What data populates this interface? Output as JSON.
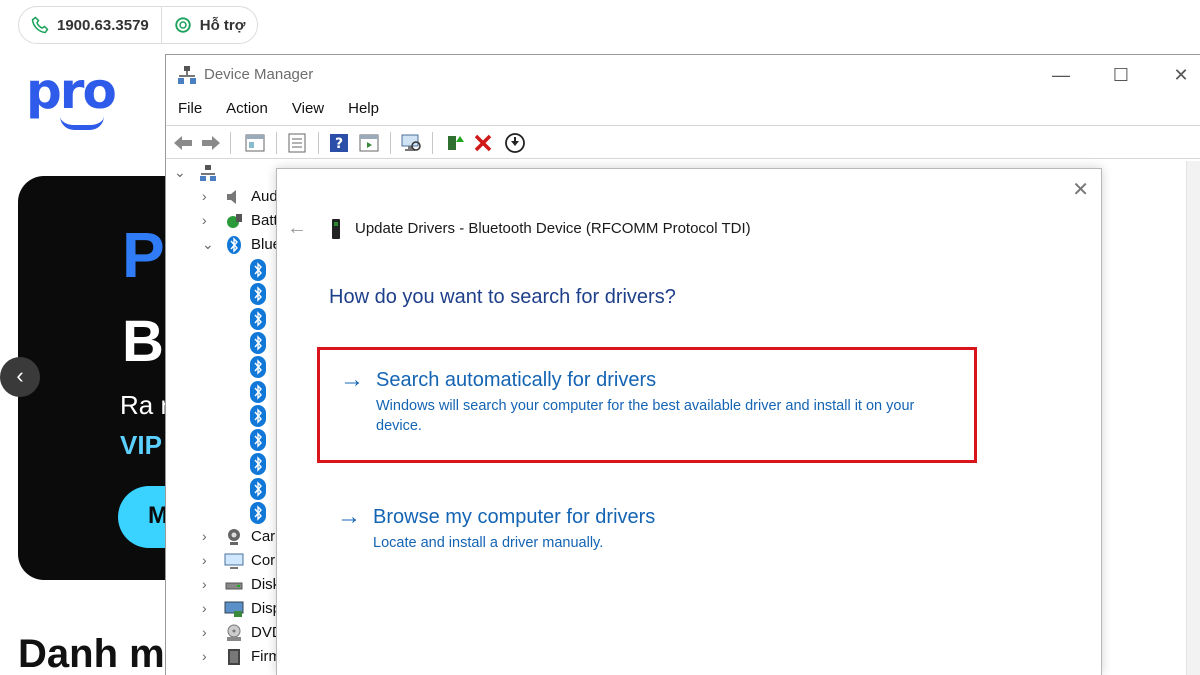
{
  "site": {
    "phone": "1900.63.3579",
    "support": "Hỗ trợ",
    "logo": "pro",
    "promo_lines": [
      "P",
      "B",
      "Ra r",
      "VIP",
      "M"
    ],
    "heading": "Danh m"
  },
  "device_manager": {
    "title": "Device Manager",
    "menu": [
      "File",
      "Action",
      "View",
      "Help"
    ],
    "tree": {
      "items": [
        {
          "label": "Aud"
        },
        {
          "label": "Batt"
        },
        {
          "label": "Blue"
        },
        {
          "label": "Car"
        },
        {
          "label": "Cor"
        },
        {
          "label": "Disk"
        },
        {
          "label": "Disp"
        },
        {
          "label": "DVD"
        },
        {
          "label": "Firm"
        }
      ]
    }
  },
  "dialog": {
    "title": "Update Drivers - Bluetooth Device (RFCOMM Protocol TDI)",
    "question": "How do you want to search for drivers?",
    "options": [
      {
        "title": "Search automatically for drivers",
        "description": "Windows will search your computer for the best available driver and install it on your device."
      },
      {
        "title": "Browse my computer for drivers",
        "description": "Locate and install a driver manually."
      }
    ]
  },
  "colors": {
    "link_blue": "#1464b4",
    "heading_blue": "#1e3f8a",
    "highlight_red": "#d9151b",
    "brand_blue": "#2f5bea"
  }
}
